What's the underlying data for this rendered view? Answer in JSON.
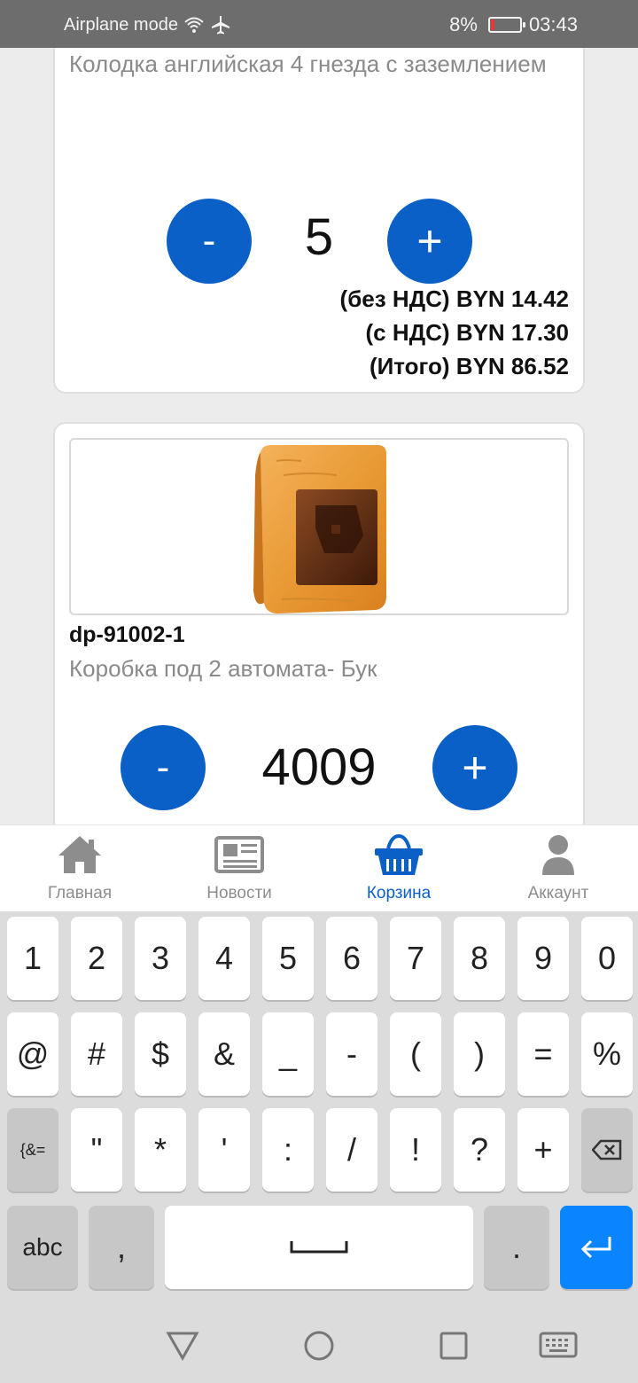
{
  "status_bar": {
    "airplane_text": "Airplane mode",
    "battery": "8%",
    "time": "03:43"
  },
  "cart": {
    "items": [
      {
        "description": "Колодка английская 4 гнезда с заземлением",
        "minus": "-",
        "quantity": "5",
        "plus": "+",
        "price_no_vat": "(без НДС) BYN 14.42",
        "price_vat": "(с НДС) BYN 17.30",
        "price_total": "(Итого) BYN 86.52"
      },
      {
        "sku": "dp-91002-1",
        "description": "Коробка под 2 автомата- Бук",
        "minus": "-",
        "quantity": "4009",
        "plus": "+"
      }
    ]
  },
  "bottom_nav": {
    "items": [
      {
        "label": "Главная",
        "icon": "home-icon"
      },
      {
        "label": "Новости",
        "icon": "news-icon"
      },
      {
        "label": "Корзина",
        "icon": "basket-icon",
        "active": true
      },
      {
        "label": "Аккаунт",
        "icon": "account-icon"
      }
    ],
    "accent": "#0a60c6"
  },
  "keyboard": {
    "row1": [
      "1",
      "2",
      "3",
      "4",
      "5",
      "6",
      "7",
      "8",
      "9",
      "0"
    ],
    "row2": [
      "@",
      "#",
      "$",
      "&",
      "_",
      "-",
      "(",
      ")",
      "=",
      "%"
    ],
    "row3": [
      "{&=",
      "\"",
      "*",
      "'",
      ":",
      "/",
      "!",
      "?",
      "+"
    ],
    "row4": {
      "abc": "abc",
      "comma": ",",
      "period": "."
    }
  }
}
